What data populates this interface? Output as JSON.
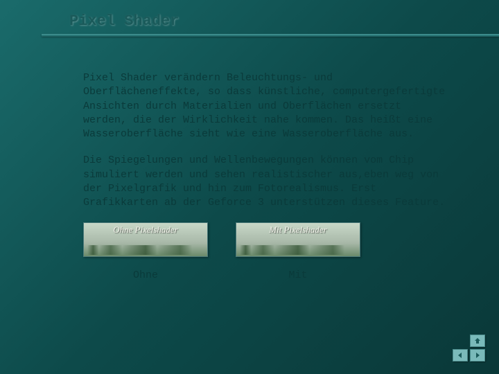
{
  "title": "Pixel Shader",
  "paragraphs": {
    "p1": "Pixel Shader verändern Beleuchtungs- und Oberflächeneffekte, so dass künstliche, computergefertigte Ansichten durch Materialien und Oberflächen ersetzt werden, die der Wirklichkeit nahe kommen. Das heißt eine Wasseroberfläche sieht wie eine Wasseroberfläche aus.",
    "p2": "Die Spiegelungen und Wellenbewegungen können vom Chip simuliert werden und sehen realistischer aus,eben weg von der Pixelgrafik und hin zum Fotorealismus. Erst Grafikkarten ab der Geforce 3 unterstützen dieses Feature."
  },
  "images": {
    "left_label": "Ohne Pixelshader",
    "right_label": "Mit Pixelshader"
  },
  "captions": {
    "left": "Ohne",
    "right": "Mit"
  }
}
